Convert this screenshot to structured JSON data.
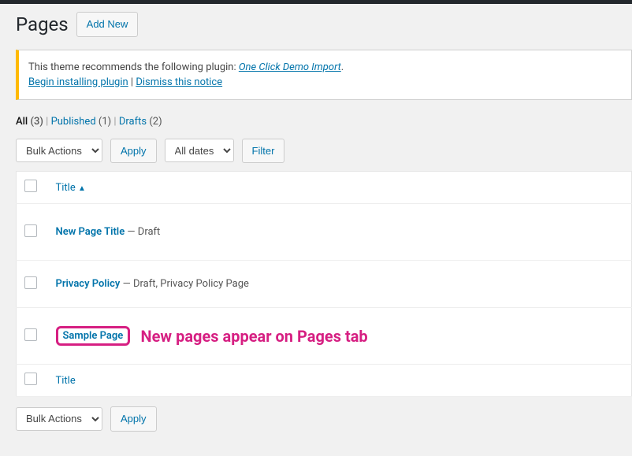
{
  "header": {
    "title": "Pages",
    "add_new": "Add New"
  },
  "notice": {
    "line1_prefix": "This theme recommends the following plugin: ",
    "plugin": "One Click Demo Import",
    "line1_suffix": ".",
    "install": "Begin installing plugin",
    "sep": " | ",
    "dismiss": "Dismiss this notice"
  },
  "filters": {
    "all_label": "All",
    "all_count": "(3)",
    "published_label": "Published",
    "published_count": "(1)",
    "drafts_label": "Drafts",
    "drafts_count": "(2)",
    "sep": "  |  "
  },
  "controls": {
    "bulk_actions": "Bulk Actions",
    "apply": "Apply",
    "all_dates": "All dates",
    "filter": "Filter"
  },
  "table": {
    "col_title": "Title",
    "sort_indicator": "▲",
    "rows": [
      {
        "title": "New Page Title",
        "state": " — Draft"
      },
      {
        "title": "Privacy Policy",
        "state": " — Draft, Privacy Policy Page"
      },
      {
        "title": "Sample Page",
        "state": ""
      }
    ]
  },
  "annotation": {
    "text": "New pages appear on Pages tab",
    "highlight_color": "#d61f82"
  }
}
